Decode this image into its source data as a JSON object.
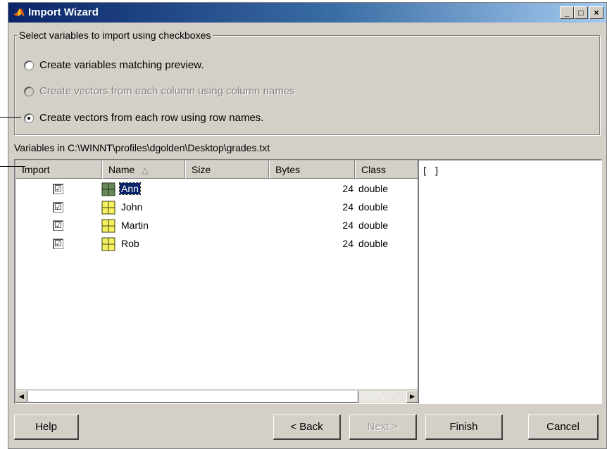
{
  "window": {
    "title": "Import Wizard",
    "minimize_glyph": "_",
    "maximize_glyph": "□",
    "close_glyph": "×"
  },
  "options": {
    "legend": "Select variables to import using checkboxes",
    "radios": [
      {
        "label": "Create variables matching preview.",
        "checked": false,
        "enabled": true
      },
      {
        "label": "Create vectors from each column using column names.",
        "checked": false,
        "enabled": false
      },
      {
        "label": "Create vectors from each row using row names.",
        "checked": true,
        "enabled": true
      }
    ]
  },
  "variables_label": "Variables in C:\\WINNT\\profiles\\dgolden\\Desktop\\grades.txt",
  "table": {
    "columns": [
      "Import",
      "Name",
      "Size",
      "Bytes",
      "Class"
    ],
    "sort_indicator": "△",
    "rows": [
      {
        "checked": "☑",
        "name": "Ann",
        "size": "",
        "bytes": "24",
        "class": "double"
      },
      {
        "checked": "☑",
        "name": "John",
        "size": "",
        "bytes": "24",
        "class": "double"
      },
      {
        "checked": "☑",
        "name": "Martin",
        "size": "",
        "bytes": "24",
        "class": "double"
      },
      {
        "checked": "☑",
        "name": "Rob",
        "size": "",
        "bytes": "24",
        "class": "double"
      }
    ],
    "scroll_left": "◀",
    "scroll_right": "▶"
  },
  "preview": {
    "text": "[ ]"
  },
  "buttons": {
    "help": "Help",
    "back": "< Back",
    "next": "Next >",
    "finish": "Finish",
    "cancel": "Cancel"
  },
  "colors": {
    "face": "#d4d0c8",
    "title_start": "#0a246a",
    "title_end": "#a6caf0",
    "selection": "#0a246a"
  }
}
